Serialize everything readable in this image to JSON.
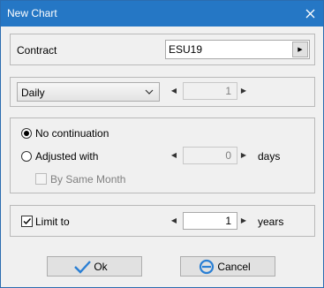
{
  "window": {
    "title": "New Chart"
  },
  "contract": {
    "label": "Contract",
    "value": "ESU19"
  },
  "period": {
    "selected": "Daily",
    "count": "1"
  },
  "continuation": {
    "no_label": "No continuation",
    "adjusted_label": "Adjusted with",
    "adjusted_value": "0",
    "days_label": "days",
    "same_month_label": "By Same Month"
  },
  "limit": {
    "label": "Limit to",
    "value": "1",
    "unit_label": "years"
  },
  "buttons": {
    "ok_label": "Ok",
    "cancel_label": "Cancel"
  },
  "colors": {
    "titlebar": "#2577c5",
    "ok_icon": "#2a7fd4",
    "cancel_icon": "#2a7fd4"
  },
  "icons": {
    "close": "close-icon",
    "ok": "checkmark-icon",
    "cancel": "prohibited-icon",
    "browse": "arrow-right-icon",
    "dropdown": "chevron-down-icon"
  }
}
